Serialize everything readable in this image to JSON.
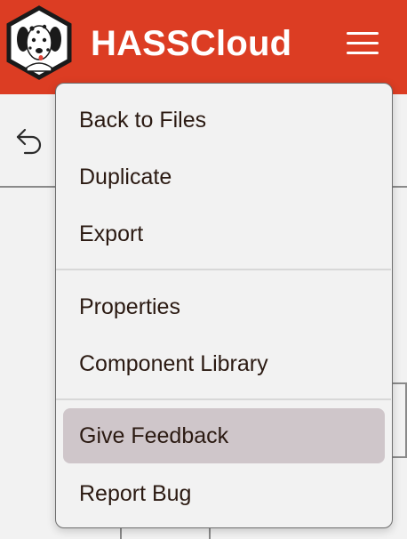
{
  "header": {
    "title": "HASSCloud",
    "logo_icon": "dalmatian-logo-icon",
    "menu_icon": "hamburger-menu-icon"
  },
  "toolbar": {
    "undo_icon": "undo-arrow-icon"
  },
  "menu": {
    "groups": [
      {
        "items": [
          {
            "label": "Back to Files"
          },
          {
            "label": "Duplicate"
          },
          {
            "label": "Export"
          }
        ]
      },
      {
        "items": [
          {
            "label": "Properties"
          },
          {
            "label": "Component Library"
          }
        ]
      },
      {
        "items": [
          {
            "label": "Give Feedback",
            "highlighted": true
          },
          {
            "label": "Report Bug"
          }
        ]
      }
    ]
  },
  "colors": {
    "brand": "#dc3d23",
    "background": "#f2f2f2",
    "menu_text": "#2b1a12",
    "highlight": "#cfc6ca"
  }
}
